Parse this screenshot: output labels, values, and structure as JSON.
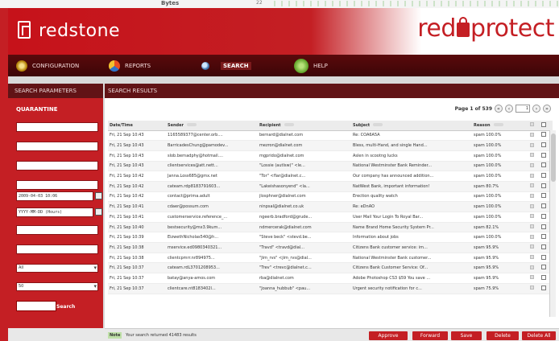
{
  "background_window": {
    "label": "Bytes",
    "value": "22"
  },
  "header": {
    "brand": "redstone",
    "product_prefix": "red",
    "product_suffix": "protect"
  },
  "nav": {
    "items": [
      {
        "label": "CONFIGURATION",
        "icon": "gear-icon"
      },
      {
        "label": "REPORTS",
        "icon": "pie-chart-icon"
      },
      {
        "label": "SEARCH",
        "icon": "magnifier-icon"
      },
      {
        "label": "HELP",
        "icon": "help-icon"
      }
    ]
  },
  "left_panel": {
    "title": "SEARCH PARAMETERS",
    "section": "QUARANTINE",
    "date_value": "2009-04-03 10:06",
    "date_format": "YYYY-MM-DD (Hours)",
    "select_1": "All",
    "select_2": "50",
    "search_button": "Search"
  },
  "results": {
    "title": "SEARCH RESULTS",
    "pager": {
      "label": "Page 1 of 539",
      "current": "1"
    },
    "columns": [
      "Date/Time",
      "Sender",
      "Recipient",
      "Subject",
      "Reason"
    ],
    "rows": [
      [
        "Fri, 21 Sep 10:43",
        "1165589377@center.orb....",
        "bernard@dialnet.com",
        "Re: COA6A5A",
        "spam 100.0%"
      ],
      [
        "Fri, 21 Sep 10:43",
        "BarricadesChung@pamodev...",
        "mezron@dialnet.com",
        "Bless, multi-Hand, and single Hand...",
        "spam 100.0%"
      ],
      [
        "Fri, 21 Sep 10:43",
        "slob.bernadphy@hotmail....",
        "mgprido@dialnet.com",
        "Aslen in scootng Iucks",
        "spam 100.0%"
      ],
      [
        "Fri, 21 Sep 10:43",
        "clientservices@att.nett...",
        "\"Lossie (autlsw)\" <le...",
        "National Westminster Bank Reminder...",
        "spam 100.0%"
      ],
      [
        "Fri, 21 Sep 10:42",
        "Janna.Loss685@gmx.net",
        "\"Tor\" <flar@dialnet.c...",
        "Our company has announced addition...",
        "spam 100.0%"
      ],
      [
        "Fri, 21 Sep 10:42",
        "cateam.rdp8183791603...",
        "\"Lakeishasonyend\" <la...",
        "NatWest Bank, important information!",
        "spam 80.7%"
      ],
      [
        "Fri, 21 Sep 10:42",
        "contact@prima.adult",
        "jlosphner@dialnet.com",
        "Erection quality watch",
        "spam 100.0%"
      ],
      [
        "Fri, 21 Sep 10:41",
        "cdaer@possum.com",
        "ninpsal@dialnet.co.uk",
        "Re: eDnAO",
        "spam 100.0%"
      ],
      [
        "Fri, 21 Sep 10:41",
        "customerservice.reference_...",
        "ngeerb.bradford@grude...",
        "User Mail Your Login To Royal Bar...",
        "spam 100.0%"
      ],
      [
        "Fri, 21 Sep 10:40",
        "bestsecurity@mx3.9kum...",
        "ndmercerak@dialnet.com",
        "Name Brand Home Security System Pr...",
        "spam 82.1%"
      ],
      [
        "Fri, 21 Sep 10:39",
        "EizwethNicholas540@h...",
        "\"Steve beck\" <stevd.be...",
        "Information about jobs",
        "spam 100.0%"
      ],
      [
        "Fri, 21 Sep 10:38",
        "mservice.ed0980340321...",
        "\"Travd\" <travd@dial...",
        "Citizens Bank customer service: im...",
        "spam 95.9%"
      ],
      [
        "Fri, 21 Sep 10:38",
        "clientcpmrr.nr894975...",
        "\"Jim_rvs\" <jim_rvs@dial...",
        "National Westminster Bank customer...",
        "spam 95.9%"
      ],
      [
        "Fri, 21 Sep 10:37",
        "cateam.rdL3701208953...",
        "\"Trev\" <trevc@dialnet.c...",
        "Citizens Bank Customer Service: Of...",
        "spam 95.9%"
      ],
      [
        "Fri, 21 Sep 10:37",
        "batay@anya-amos.com",
        "rba@dialnet.com",
        "Adobe Photoshop CS3 $59 You save ...",
        "spam 95.9%"
      ],
      [
        "Fri, 21 Sep 10:37",
        "clientcare.nt8183402l...",
        "\"Joanna_hubbub\" <pau...",
        "Urgent security notification for c...",
        "spam 75.9%"
      ]
    ]
  },
  "status": {
    "tag": "Note",
    "text": "Your search returned 41483 results",
    "buttons": [
      "Approve",
      "Forward",
      "Save",
      "Delete",
      "Delete All"
    ]
  }
}
